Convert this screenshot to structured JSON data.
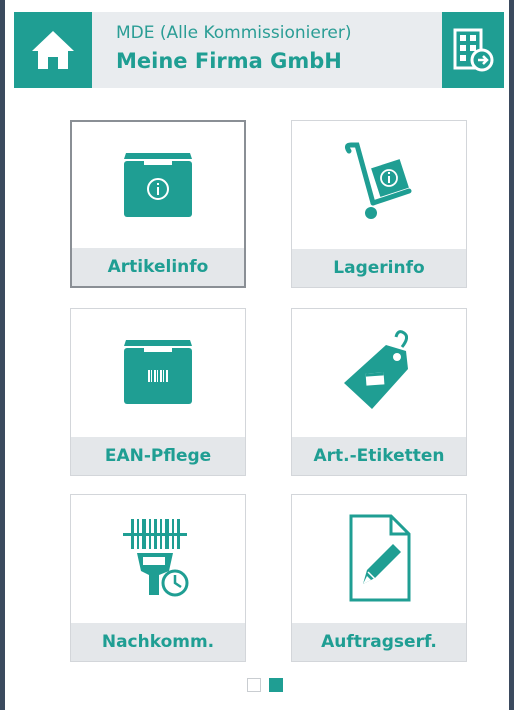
{
  "header": {
    "subtitle": "MDE (Alle Kommissionierer)",
    "title": "Meine Firma GmbH"
  },
  "icons": {
    "home": "home-icon",
    "warehouse": "warehouse-switch-icon"
  },
  "tiles": [
    {
      "label": "Artikelinfo",
      "icon": "box-info-icon"
    },
    {
      "label": "Lagerinfo",
      "icon": "handtruck-info-icon"
    },
    {
      "label": "EAN-Pflege",
      "icon": "box-barcode-icon"
    },
    {
      "label": "Art.-Etiketten",
      "icon": "price-tag-icon"
    },
    {
      "label": "Nachkomm.",
      "icon": "barcode-scanner-clock-icon"
    },
    {
      "label": "Auftragserf.",
      "icon": "document-edit-icon"
    }
  ],
  "pager": {
    "pages": 2,
    "current": 2
  },
  "colors": {
    "accent": "#1f9e93",
    "header_bg": "#e9ecef",
    "label_bg": "#e4e7ea",
    "frame": "#3b4a5e"
  }
}
